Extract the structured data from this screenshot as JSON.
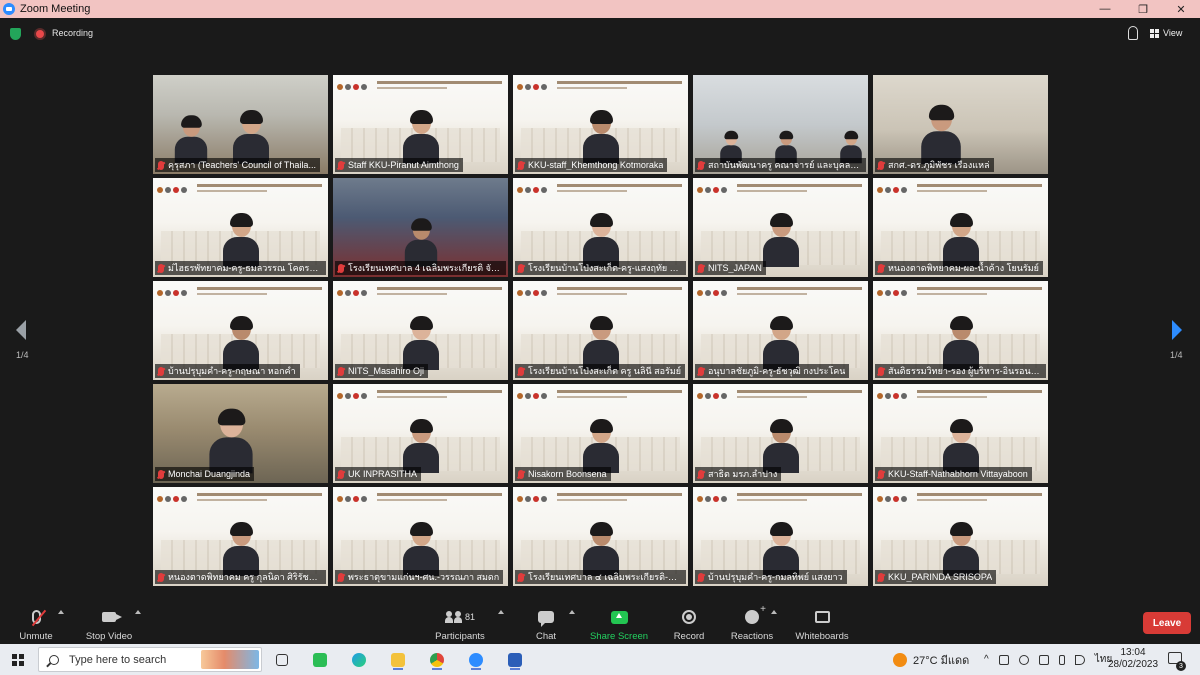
{
  "window": {
    "title": "Zoom Meeting",
    "controls": [
      "—",
      "❐",
      "✕"
    ]
  },
  "topbar": {
    "recording_label": "Recording",
    "view_label": "View"
  },
  "gallery": {
    "page_indicator_left": "1/4",
    "page_indicator_right": "1/4",
    "tiles": [
      {
        "name": "คุรุสภา (Teachers' Council of Thaila...",
        "scene": "room"
      },
      {
        "name": "Staff KKU-Piranut Aimthong",
        "scene": "slide"
      },
      {
        "name": "KKU-staff_Khemthong Kotmoraka",
        "scene": "slide"
      },
      {
        "name": "สถาบันพัฒนาครู คณาจารย์ และบุคลากร...",
        "scene": "office"
      },
      {
        "name": "สกศ.-ดร.ภูมิพัชร เรืองแหล่",
        "scene": "room2"
      },
      {
        "name": "ม่ไฮธรพัทยาคม-ครู-ธมลวรรณ โคตรพันธ์",
        "scene": "slide"
      },
      {
        "name": "โรงเรียนเทศบาล 4 เฉลิมพระเกียรติ จังหว...",
        "scene": "classroom"
      },
      {
        "name": "โรงเรียนบ้านโป่งสะเก็ต-ครู-แสงฤทัย บุญ...",
        "scene": "slide"
      },
      {
        "name": "NITS_JAPAN",
        "scene": "slide"
      },
      {
        "name": "หนองตาดพิทยาคม-ผอ-น้ำค้าง โยนรัมย์",
        "scene": "slide"
      },
      {
        "name": "บ้านปรุบุมคำ-ครู-กฤษณา หอกคำ",
        "scene": "slide"
      },
      {
        "name": "NITS_Masahiro Oji",
        "scene": "slide"
      },
      {
        "name": "โรงเรียนบ้านโป่งสะเก็ต ครู นลินี สอรัมย์",
        "scene": "slide"
      },
      {
        "name": "อนุบาลชัยภูมิ-ครู-ธัชวุฒิ กงประโคน",
        "scene": "slide"
      },
      {
        "name": "สันติธรรมวิทยา-รอง ผู้บริหาร-อินรอน สะ...",
        "scene": "slide"
      },
      {
        "name": "Monchai Duangjinda",
        "scene": "blurroom"
      },
      {
        "name": "UK INPRASITHA",
        "scene": "slide"
      },
      {
        "name": "Nisakorn Boonsena",
        "scene": "slide"
      },
      {
        "name": "สาธิต มรภ.ลำปาง",
        "scene": "slide"
      },
      {
        "name": "KKU-Staff-Nathabhorn Vittayaboon",
        "scene": "slide"
      },
      {
        "name": "หนองตาดพิทยาคม ครู กุลนิดา ศิริรัชพันธ์",
        "scene": "slide"
      },
      {
        "name": "พระธาตุขามแก่นฯ-ศน.-วรรณภา สมดก",
        "scene": "slide"
      },
      {
        "name": "โรงเรียนเทศบาล ๔ เฉลิมพระเกียรติ-ผอ....",
        "scene": "slide"
      },
      {
        "name": "บ้านปรุบุมคำ-ครู-กมลทิพย์ แสงยาว",
        "scene": "slide"
      },
      {
        "name": "KKU_PARINDA SRISOPA",
        "scene": "slide"
      }
    ]
  },
  "toolbar": {
    "unmute": "Unmute",
    "stop_video": "Stop Video",
    "participants": "Participants",
    "participants_count": "81",
    "chat": "Chat",
    "share_screen": "Share Screen",
    "record": "Record",
    "reactions": "Reactions",
    "whiteboards": "Whiteboards",
    "leave": "Leave"
  },
  "taskbar": {
    "search_placeholder": "Type here to search",
    "weather": "27°C มีแดด",
    "language": "ไทย",
    "time": "13:04",
    "date": "28/02/2023",
    "notification_count": "3"
  },
  "colors": {
    "accent": "#2d8cff",
    "share_green": "#23c552",
    "leave_red": "#d83b36",
    "mute_red": "#e03c3c"
  }
}
